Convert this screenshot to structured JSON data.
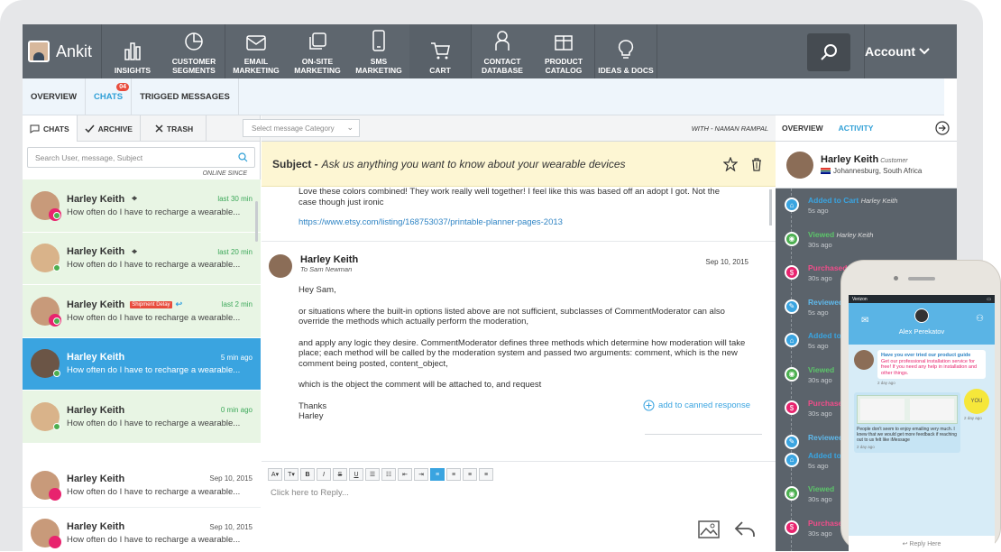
{
  "brand": {
    "name": "Ankit"
  },
  "nav": [
    {
      "label": "INSIGHTS",
      "icon": "bar-chart-icon"
    },
    {
      "label": "CUSTOMER SEGMENTS",
      "icon": "pie-chart-icon"
    },
    {
      "label": "EMAIL MARKETING",
      "icon": "envelope-icon"
    },
    {
      "label": "ON-SITE MARKETING",
      "icon": "window-icon"
    },
    {
      "label": "SMS MARKETING",
      "icon": "phone-icon"
    },
    {
      "label": "CART",
      "icon": "cart-icon"
    },
    {
      "label": "CONTACT DATABASE",
      "icon": "person-icon"
    },
    {
      "label": "PRODUCT CATALOG",
      "icon": "gift-icon"
    },
    {
      "label": "IDEAS & DOCS",
      "icon": "bulb-icon"
    }
  ],
  "account_label": "Account",
  "subnav": {
    "overview": "OVERVIEW",
    "chats": "CHATS",
    "chats_badge": "04",
    "trigged": "TRIGGED MESSAGES"
  },
  "left": {
    "tabs": {
      "chats": "CHATS",
      "archive": "ARCHIVE",
      "trash": "TRASH"
    },
    "search_placeholder": "Search User, message, Subject",
    "online_since": "ONLINE SINCE",
    "chats": [
      {
        "name": "Harley Keith",
        "time": "last 30 min",
        "snippet": "How often do I have to recharge a wearable...",
        "style": "green"
      },
      {
        "name": "Harley Keith",
        "time": "last 20 min",
        "snippet": "How often do I have to recharge a wearable...",
        "style": "green"
      },
      {
        "name": "Harley Keith",
        "tag": "Shipment Delay",
        "time": "last 2 min",
        "snippet": "How often do I have to recharge a wearable...",
        "style": "green"
      },
      {
        "name": "Harley Keith",
        "time": "5 min ago",
        "snippet": "How often do I have to recharge a wearable...",
        "style": "selected"
      },
      {
        "name": "Harley Keith",
        "time": "0 min ago",
        "snippet": "How often do I have to recharge a wearable...",
        "style": "green"
      },
      {
        "name": "Harley Keith",
        "time": "Sep 10, 2015",
        "snippet": "How often do I have to recharge a wearable...",
        "style": "white"
      },
      {
        "name": "Harley Keith",
        "time": "Sep 10, 2015",
        "snippet": "How often do I have to recharge a wearable...",
        "style": "white"
      }
    ]
  },
  "mid": {
    "category_placeholder": "Select message Category",
    "with": "WITH - NAMAN RAMPAL",
    "subject_label": "Subject -",
    "subject_text": "Ask us anything you want to know about your wearable devices",
    "msg1_text": "Love these colors combined! They work really well together! I feel like this was based off an adopt I got. Not the case though just ironic",
    "msg1_link": "https://www.etsy.com/listing/168753037/printable-planner-pages-2013",
    "msg2": {
      "name": "Harley Keith",
      "to": "To Sam Newman",
      "date": "Sep 10, 2015",
      "p1": "Hey Sam,",
      "p2": "or situations where the built-in options listed above are not sufficient, subclasses of CommentModerator can also override the methods which actually perform the moderation,",
      "p3": "and apply any logic they desire. CommentModerator defines three methods which determine how moderation will take place; each method will be called by the moderation system and passed two arguments: comment, which is the new comment being posted, content_object,",
      "p4": "which is the object the comment will be attached to, and request",
      "p5a": "Thanks",
      "p5b": "Harley"
    },
    "canned": "add to canned response",
    "reply_placeholder": "Click here to Reply..."
  },
  "right": {
    "tab_overview": "OVERVIEW",
    "tab_activity": "ACTIVITY",
    "profile": {
      "name": "Harley Keith",
      "role": "Customer",
      "location": "Johannesburg, South Africa"
    },
    "activity": [
      {
        "action": "Added to Cart",
        "by": "Harley Keith",
        "time": "5s ago",
        "kind": "cart"
      },
      {
        "action": "Viewed",
        "by": "Harley Keith",
        "time": "30s ago",
        "kind": "view"
      },
      {
        "action": "Purchased",
        "by": "",
        "time": "30s ago",
        "kind": "purch"
      },
      {
        "action": "Reviewed",
        "by": "",
        "time": "5s ago",
        "kind": "rev"
      },
      {
        "action": "Added to",
        "by": "",
        "time": "5s ago",
        "kind": "cart"
      },
      {
        "action": "Viewed",
        "by": "",
        "time": "30s ago",
        "kind": "view"
      },
      {
        "action": "Purchased",
        "by": "",
        "time": "30s ago",
        "kind": "purch"
      },
      {
        "action": "Reviewed",
        "by": "",
        "time": "",
        "kind": "rev"
      },
      {
        "action": "Added to",
        "by": "",
        "time": "5s ago",
        "kind": "cart"
      },
      {
        "action": "Viewed",
        "by": "",
        "time": "30s ago",
        "kind": "view"
      },
      {
        "action": "Purchased",
        "by": "",
        "time": "30s ago",
        "kind": "purch"
      }
    ]
  },
  "phone": {
    "carrier": "Verizon",
    "name": "Alex Perekatov",
    "bubble1_head": "Have you ever tried our product guide",
    "bubble1_body": "Get our professional installation service for free! If you need any help in installation and other things.",
    "bubble1_time": "2 day ago",
    "bubble2_body": "People don't seem to enjoy emailing very much. I knew that we would get more feedback if reaching out to us felt like iMessage",
    "bubble2_time": "2 day ago",
    "you": "YOU",
    "you_time": "2 day ago",
    "reply": "Reply Here"
  }
}
